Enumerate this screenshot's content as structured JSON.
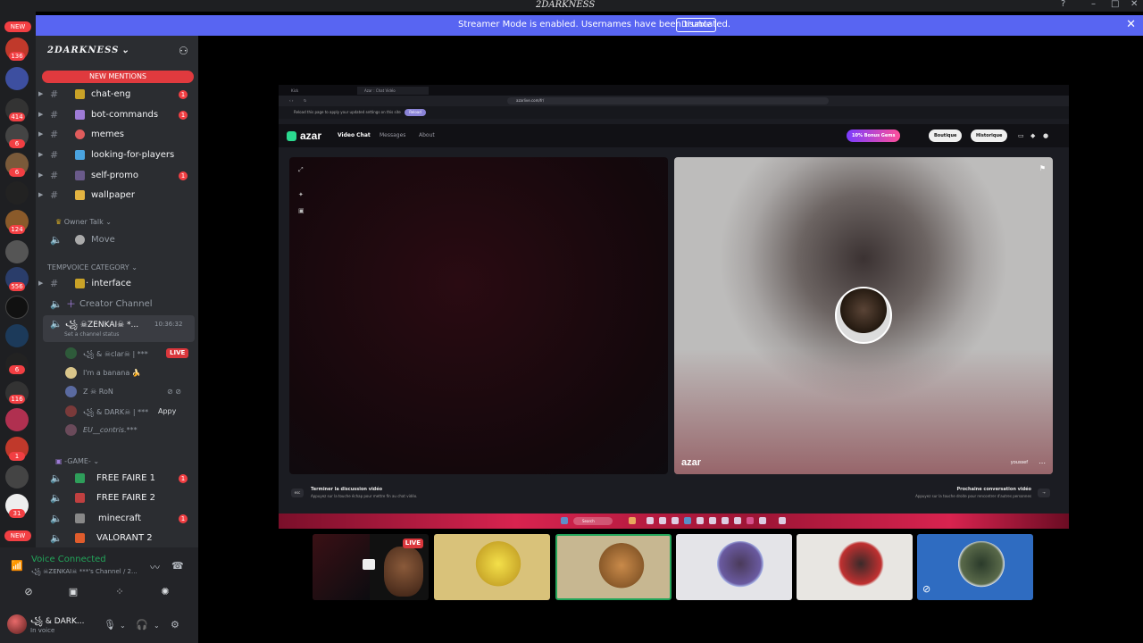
{
  "window": {
    "title": "2DARKNESS"
  },
  "banner": {
    "text": "Streamer Mode is enabled. Usernames have been truncated.",
    "disable_label": "Disable"
  },
  "server_rail": {
    "new_top": "NEW",
    "new_bottom": "NEW",
    "badges": [
      "136",
      "414",
      "6",
      "6",
      "124",
      "556",
      "6",
      "116",
      "1",
      "31"
    ]
  },
  "guild": {
    "name": "2DARKNESS",
    "new_mentions": "NEW MENTIONS",
    "text_channels": [
      {
        "name": "chat-eng",
        "unread": "1"
      },
      {
        "name": "bot-commands",
        "unread": "1"
      },
      {
        "name": "memes",
        "unread": ""
      },
      {
        "name": "looking-for-players",
        "unread": ""
      },
      {
        "name": "self-promo",
        "unread": "1"
      },
      {
        "name": "wallpaper",
        "unread": ""
      }
    ],
    "owner_talk": "Owner Talk",
    "move_channel": "Move",
    "tempvoice_category": "TEMPVOICE CATEGORY",
    "interface_channel": "· interface",
    "creator_channel": "Creator Channel",
    "active_voice": {
      "name": "꧁ ☠ZENKAI☠ *...",
      "timer": "10:36:32",
      "status_hint": "Set a channel status"
    },
    "voice_users": [
      {
        "name": "꧁ & ☠clar☠ | ***",
        "live": "LIVE"
      },
      {
        "name": "I'm a banana 🍌",
        "live": ""
      },
      {
        "name": "Z ☠ RoN",
        "live": ""
      },
      {
        "name": "꧁ & DARK☠ | ***",
        "live": "",
        "extra": "Appy"
      },
      {
        "name": "EU__contris.***",
        "live": ""
      }
    ],
    "game_category": "-GAME-",
    "game_channels": [
      {
        "name": "FREE FAIRE 1",
        "unread": "1"
      },
      {
        "name": "FREE FAIRE 2",
        "unread": ""
      },
      {
        "name": "minecraft",
        "unread": "1"
      },
      {
        "name": "VALORANT 2",
        "unread": ""
      }
    ]
  },
  "voice_panel": {
    "status": "Voice Connected",
    "channel": "꧁ ☠ZENKAI☠ ***'s Channel / 2...",
    "username": "꧁ & DARK...",
    "user_status": "In voice"
  },
  "shared_screen": {
    "browser": {
      "url": "azarlive.com/fr/",
      "info_text": "Reload this page to apply your updated settings on this site",
      "reload_label": "Reload"
    },
    "azar": {
      "logo": "azar",
      "nav": [
        "Video Chat",
        "Messages",
        "About"
      ],
      "promo": "10% Bonus Gems",
      "shop": "Boutique",
      "history": "Historique",
      "watermark": "azar",
      "peer_name": "youssef",
      "end_title": "Terminer la discussion vidéo",
      "end_hint": "Appuyez sur la touche échap pour mettre fin au chat vidéo.",
      "end_key": "esc",
      "next_title": "Prochaine conversation vidéo",
      "next_hint": "Appuyez sur la touche droite pour rencontrer d'autres personnes",
      "taskbar_search": "Search"
    }
  },
  "participants": {
    "live_label": "LIVE",
    "count": 6
  },
  "colors": {
    "discord_blurple": "#5865f2",
    "live_red": "#da373c",
    "connected_green": "#23a55a",
    "azar_green": "#2bd98f"
  }
}
